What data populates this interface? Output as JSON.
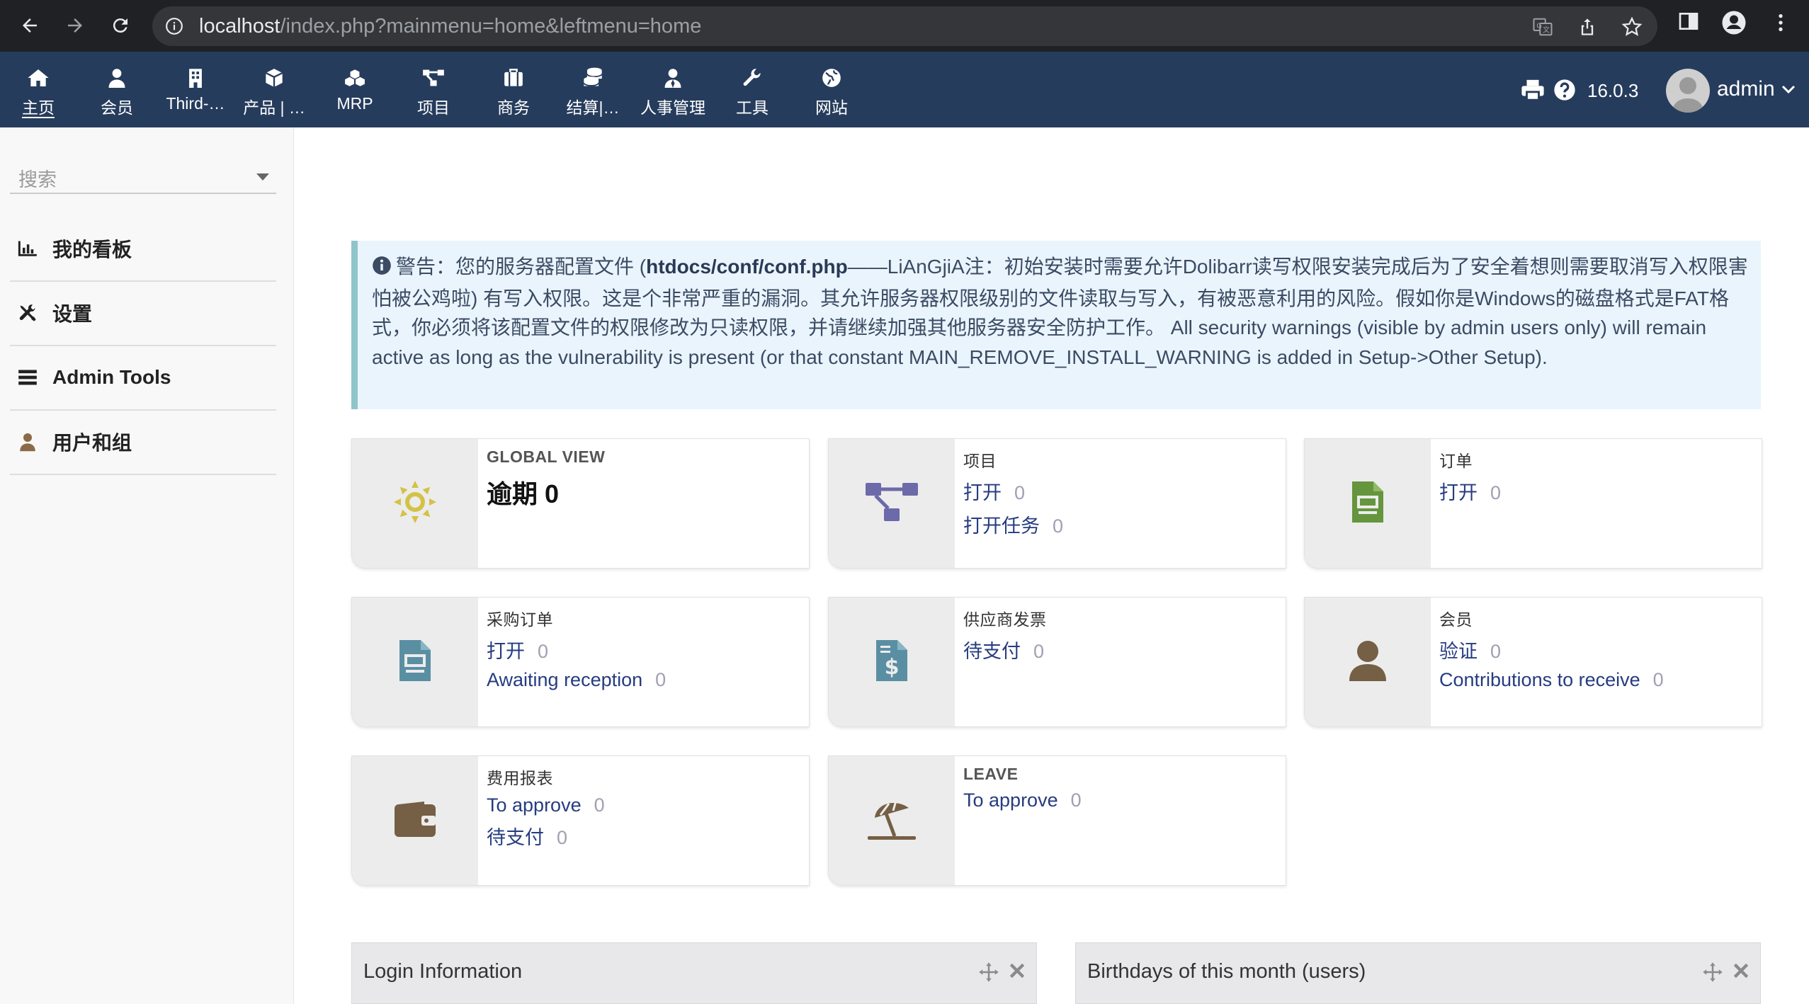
{
  "browser": {
    "url_host": "localhost",
    "url_path": "/index.php?mainmenu=home&leftmenu=home"
  },
  "topnav": {
    "items": [
      {
        "label": "主页",
        "icon": "home-icon"
      },
      {
        "label": "会员",
        "icon": "user-icon"
      },
      {
        "label": "Third-…",
        "icon": "building-icon"
      },
      {
        "label": "产品 | …",
        "icon": "cube-icon"
      },
      {
        "label": "MRP",
        "icon": "cubes-icon"
      },
      {
        "label": "项目",
        "icon": "project-icon"
      },
      {
        "label": "商务",
        "icon": "suitcase-icon"
      },
      {
        "label": "结算|…",
        "icon": "coins-icon"
      },
      {
        "label": "人事管理",
        "icon": "user-tie-icon"
      },
      {
        "label": "工具",
        "icon": "wrench-icon"
      },
      {
        "label": "网站",
        "icon": "globe-icon"
      }
    ],
    "version": "16.0.3",
    "user": "admin"
  },
  "leftmenu": {
    "search_placeholder": "搜索",
    "items": [
      {
        "label": "我的看板",
        "icon": "chart-bar-icon"
      },
      {
        "label": "设置",
        "icon": "tools-icon"
      },
      {
        "label": "Admin Tools",
        "icon": "bars-icon"
      },
      {
        "label": "用户和组",
        "icon": "user-icon"
      }
    ]
  },
  "warning": {
    "prefix": "警告：您的服务器配置文件 (",
    "file": "htdocs/conf/conf.php",
    "text": "——LiAnGjiA注：初始安装时需要允许Dolibarr读写权限安装完成后为了安全着想则需要取消写入权限害怕被公鸡啦) 有写入权限。这是个非常严重的漏洞。其允许服务器权限级别的文件读取与写入，有被恶意利用的风险。假如你是Windows的磁盘格式是FAT格式，你必须将该配置文件的权限修改为只读权限，并请继续加强其他服务器安全防护工作。 All security warnings (visible by admin users only) will remain active as long as the vulnerability is present (or that constant MAIN_REMOVE_INSTALL_WARNING is added in Setup->Other Setup)."
  },
  "boxes": {
    "global": {
      "title": "GLOBAL VIEW",
      "big_label": "逾期",
      "big_value": "0"
    },
    "projects": {
      "title": "项目",
      "lines": [
        {
          "label": "打开",
          "count": "0"
        },
        {
          "label": "打开任务",
          "count": "0"
        }
      ]
    },
    "orders": {
      "title": "订单",
      "lines": [
        {
          "label": "打开",
          "count": "0"
        }
      ]
    },
    "purchase": {
      "title": "采购订单",
      "lines": [
        {
          "label": "打开",
          "count": "0"
        },
        {
          "label": "Awaiting reception",
          "count": "0"
        }
      ]
    },
    "supplier_invoices": {
      "title": "供应商发票",
      "lines": [
        {
          "label": "待支付",
          "count": "0"
        }
      ]
    },
    "members": {
      "title": "会员",
      "lines": [
        {
          "label": "验证",
          "count": "0"
        },
        {
          "label": "Contributions to receive",
          "count": "0"
        }
      ]
    },
    "expenses": {
      "title": "费用报表",
      "lines": [
        {
          "label": "To approve",
          "count": "0"
        },
        {
          "label": "待支付",
          "count": "0"
        }
      ]
    },
    "leave": {
      "title": "LEAVE",
      "lines": [
        {
          "label": "To approve",
          "count": "0"
        }
      ]
    }
  },
  "panels": {
    "login": {
      "title": "Login Information"
    },
    "birthdays": {
      "title": "Birthdays of this month (users)"
    }
  },
  "colors": {
    "topnav_bg": "#263c5c",
    "link": "#263c80",
    "warning_bg": "#eaf4fc",
    "sun_icon": "#d3c246",
    "project_icon": "#6c6aa8",
    "order_icon": "#65953d",
    "purchase_icon": "#5a8fa3",
    "member_icon": "#755f45",
    "expense_icon": "#755f45"
  }
}
